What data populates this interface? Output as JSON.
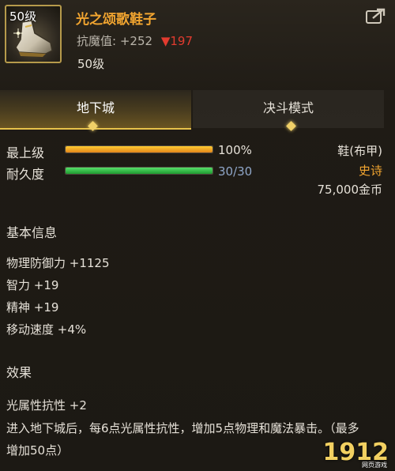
{
  "item": {
    "level_badge": "50级",
    "name": "光之颂歌鞋子",
    "resist_label": "抗魔值:",
    "resist_value": "+252",
    "resist_drop": "▼197",
    "required_level": "50级",
    "share_icon": "share-icon"
  },
  "tabs": [
    {
      "label": "地下城",
      "active": true
    },
    {
      "label": "决斗模式",
      "active": false
    }
  ],
  "stats": {
    "grade_label": "最上级",
    "grade_value": "100%",
    "grade_fraction": 1.0,
    "durability_label": "耐久度",
    "durability_value": "30/30",
    "durability_fraction": 1.0
  },
  "info": {
    "type": "鞋(布甲)",
    "rarity": "史诗",
    "price": "75,000金币"
  },
  "basic": {
    "title": "基本信息",
    "lines": [
      "物理防御力 +1125",
      "智力 +19",
      "精神 +19",
      "移动速度 +4%"
    ]
  },
  "effect": {
    "title": "效果",
    "line1": "光属性抗性 +2",
    "line2": "进入地下城后，每6点光属性抗性，增加5点物理和魔法暴击。（最多增加50点）"
  },
  "watermark": {
    "text": "1912",
    "sub": "网页游戏"
  },
  "colors": {
    "orange": "#f2a530",
    "rarity": "#f2a530",
    "red": "#e23b2f",
    "durability_text": "#8fa6c8",
    "gold_accent": "#e7c24b"
  }
}
